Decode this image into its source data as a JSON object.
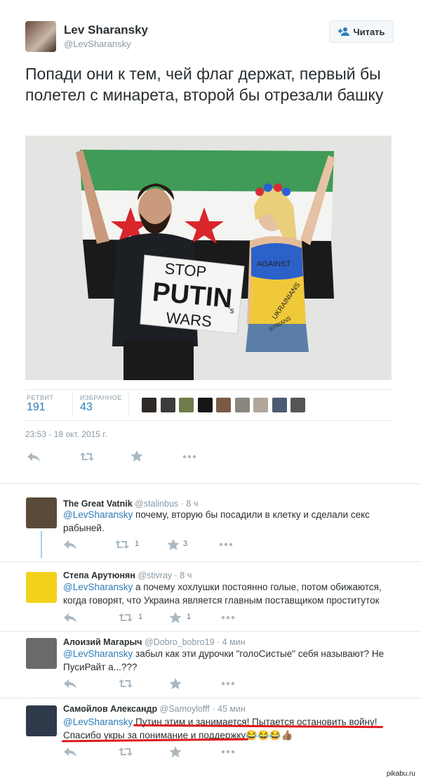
{
  "tweet": {
    "author_name": "Lev Sharansky",
    "author_handle": "@LevSharansky",
    "follow_label": "Читать",
    "text": "Попади они к тем, чей флаг держат, первый бы полетел с минарета, второй бы отрезали башку",
    "photo": {
      "sign_lines": [
        "STOP",
        "PUTIN",
        "'s",
        "WARS"
      ],
      "bodypaint": [
        "AGAINST",
        "UKRAINIANS",
        "SYRIANS"
      ]
    },
    "retweets_label": "РЕТВИТ",
    "retweets_value": "191",
    "favorites_label": "ИЗБРАННОЕ",
    "favorites_value": "43",
    "timestamp": "23:53 - 18 окт. 2015 г."
  },
  "fav_avatar_colors": [
    "#2f2a26",
    "#3b3b3b",
    "#6f7d4a",
    "#151515",
    "#7a5a45",
    "#8a8680",
    "#b2a59a",
    "#4a5a72",
    "#555555"
  ],
  "replies": [
    {
      "name": "The Great Vatnik",
      "handle": "@stalinbus",
      "time": "· 8 ч",
      "mention": "@LevSharansky",
      "text": " почему, вторую бы посадили в клетку и сделали секс рабыней.",
      "retweets": "1",
      "favorites": "3",
      "avatar_color": "#5a4a3a"
    },
    {
      "name": "Степа Арутюнян",
      "handle": "@stivray",
      "time": "· 8 ч",
      "mention": "@LevSharansky",
      "text": "  а почему хохлушки постоянно голые, потом обижаются, когда говорят, что Украина является главным поставщиком проституток",
      "retweets": "1",
      "favorites": "1",
      "avatar_color": "#f2d21b"
    },
    {
      "name": "Алоизий Магарыч",
      "handle": "@Dobro_bobro19",
      "time": "· 4 мин",
      "mention": "@LevSharansky",
      "text": " забыл как эти дурочки \"голоСистые\" себя называют? Не ПусиРайт а...???",
      "retweets": "",
      "favorites": "",
      "avatar_color": "#6a6a6a"
    },
    {
      "name": "Самойлов Александр",
      "handle": "@Samoylofff",
      "time": "· 45 мин",
      "mention": "@LevSharansky",
      "text": " Путин этим и занимается! Пытается остановить войну! Спасибо укры за понимание и поддержку😂😂😂👍🏽",
      "retweets": "",
      "favorites": "",
      "avatar_color": "#2e3a4a"
    }
  ],
  "watermark": "pikabu.ru"
}
